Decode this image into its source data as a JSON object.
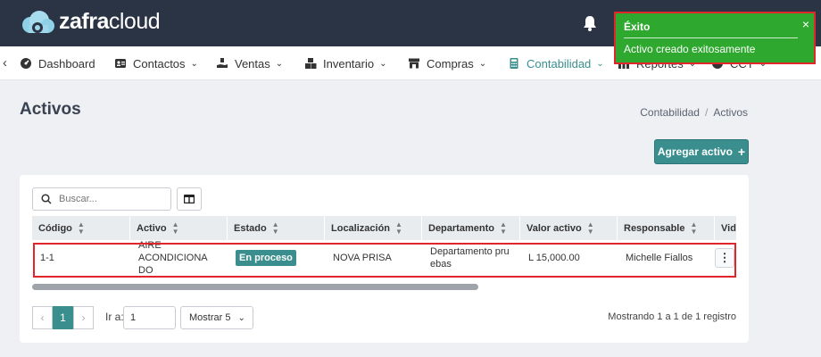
{
  "brand": {
    "bold": "zafra",
    "light": "cloud"
  },
  "nav": {
    "items": [
      {
        "label": "Dashboard",
        "icon": "dashboard-icon"
      },
      {
        "label": "Contactos",
        "icon": "contacts-icon"
      },
      {
        "label": "Ventas",
        "icon": "sales-icon"
      },
      {
        "label": "Inventario",
        "icon": "inventory-icon"
      },
      {
        "label": "Compras",
        "icon": "store-icon"
      },
      {
        "label": "Contabilidad",
        "icon": "accounting-icon"
      },
      {
        "label": "Reportes",
        "icon": "reports-icon"
      },
      {
        "label": "CCT",
        "icon": "cct-icon"
      }
    ]
  },
  "toast": {
    "title": "Éxito",
    "message": "Activo creado exitosamente",
    "close": "×"
  },
  "page": {
    "title": "Activos",
    "add_button": "Agregar activo"
  },
  "breadcrumb": {
    "parent": "Contabilidad",
    "current": "Activos"
  },
  "search": {
    "placeholder": "Buscar..."
  },
  "table": {
    "headers": [
      "Código",
      "Activo",
      "Estado",
      "Localización",
      "Departamento",
      "Valor activo",
      "Responsable",
      "Vid"
    ],
    "row": {
      "codigo": "1-1",
      "activo_1": "AIRE ACONDICIONA",
      "activo_2": "DO",
      "estado": "En proceso",
      "localizacion": "NOVA PRISA",
      "departamento_1": "Departamento pru",
      "departamento_2": "ebas",
      "valor": "L 15,000.00",
      "responsable": "Michelle Fiallos"
    }
  },
  "pagination": {
    "current_page": "1",
    "goto_label": "Ir a:",
    "goto_value": "1",
    "page_size": "Mostrar 5",
    "showing": "Mostrando 1 a 1 de 1 registro"
  },
  "colors": {
    "topbar": "#2b3445",
    "accent": "#3a8f8e",
    "toast": "#2ea82e",
    "highlight": "#e0252b"
  }
}
